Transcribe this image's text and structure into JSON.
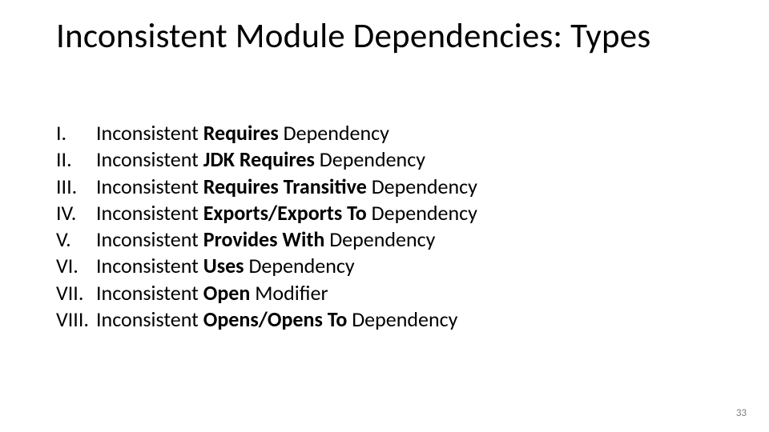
{
  "title": "Inconsistent Module Dependencies: Types",
  "items": [
    {
      "num": "I.",
      "pre": "Inconsistent ",
      "bold": "Requires",
      "post": " Dependency"
    },
    {
      "num": "II.",
      "pre": "Inconsistent ",
      "bold": "JDK Requires",
      "post": " Dependency"
    },
    {
      "num": "III.",
      "pre": "Inconsistent ",
      "bold": "Requires Transitive",
      "post": " Dependency"
    },
    {
      "num": "IV.",
      "pre": "Inconsistent ",
      "bold": "Exports/Exports To",
      "post": " Dependency"
    },
    {
      "num": "V.",
      "pre": "Inconsistent ",
      "bold": "Provides With",
      "post": " Dependency"
    },
    {
      "num": "VI.",
      "pre": "Inconsistent ",
      "bold": "Uses",
      "post": " Dependency"
    },
    {
      "num": "VII.",
      "pre": "Inconsistent ",
      "bold": "Open",
      "post": " Modifier"
    },
    {
      "num": "VIII.",
      "pre": "Inconsistent ",
      "bold": "Opens/Opens To",
      "post": " Dependency"
    }
  ],
  "page_number": "33"
}
